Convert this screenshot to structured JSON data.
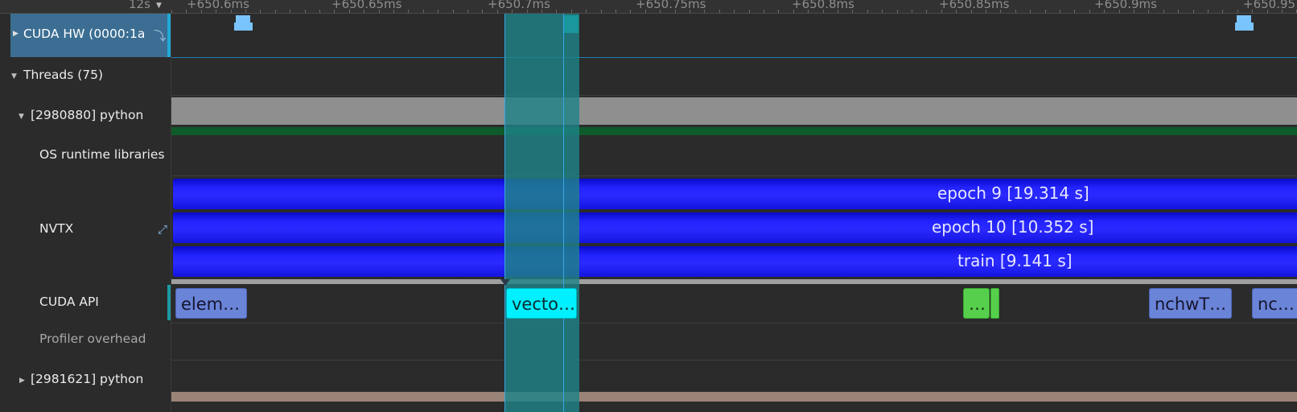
{
  "ruler": {
    "left_label": "12s",
    "ticks": [
      "+650.6ms",
      "+650.65ms",
      "+650.7ms",
      "+650.75ms",
      "+650.8ms",
      "+650.85ms",
      "+650.9ms",
      "+650.95"
    ]
  },
  "rows": {
    "cuda_hw": "CUDA HW (0000:1a",
    "threads": "Threads (75)",
    "thread1": "[2980880] python",
    "os_runtime": "OS runtime libraries",
    "nvtx": "NVTX",
    "cuda_api": "CUDA API",
    "profiler_overhead": "Profiler overhead",
    "thread2": "[2981621] python"
  },
  "nvtx_ranges": {
    "epoch9": "epoch 9 [19.314 s]",
    "epoch10": "epoch 10 [10.352 s]",
    "train": "train [9.141 s]"
  },
  "api_calls": {
    "elem": "elem…",
    "vecto": "vecto…",
    "green": "…",
    "nchw": "nchwT…",
    "nc": "nc…"
  },
  "colors": {
    "selected_row": "#3b6e92",
    "selection_highlight": "#1f6b70",
    "nvtx_blue": "#2323ff",
    "kernel_cyan": "#00f0ff",
    "memcpy_blue": "#79c3ff",
    "api_blue": "#6a84d8",
    "api_green": "#56d04c",
    "thread_bar_gray": "#8f8f8f",
    "thread_bar_green": "#0e5a2a",
    "thread2_bar": "#9a8477"
  },
  "icons": {
    "expand_icon": "⤢",
    "pin_icon": "⤵"
  }
}
